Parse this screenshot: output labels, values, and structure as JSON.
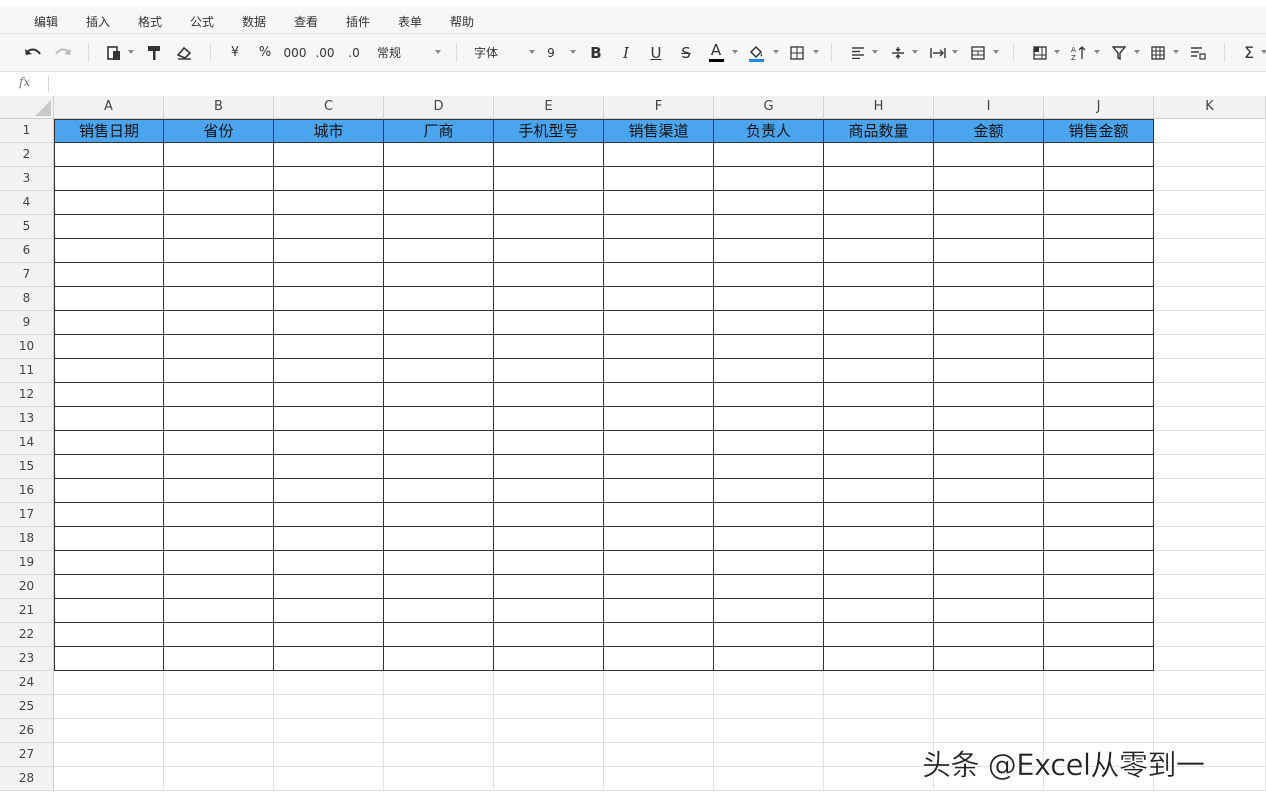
{
  "menu": [
    "编辑",
    "插入",
    "格式",
    "公式",
    "数据",
    "查看",
    "插件",
    "表单",
    "帮助"
  ],
  "toolbar": {
    "currency": "¥",
    "percent": "%",
    "thousands": "000",
    "inc_decimal": ".00",
    "dec_decimal": ".0",
    "number_format": "常规",
    "font_family": "字体",
    "font_size": "9",
    "bold": "B",
    "italic": "I",
    "underline": "U",
    "strike": "S",
    "font_color_label": "A",
    "sum": "Σ",
    "colors": {
      "font_color": "#000000",
      "fill_color": "#1e88e5"
    }
  },
  "formula_bar": {
    "fx": "fx",
    "value": ""
  },
  "columns": [
    "A",
    "B",
    "C",
    "D",
    "E",
    "F",
    "G",
    "H",
    "I",
    "J",
    "K"
  ],
  "rows": [
    "1",
    "2",
    "3",
    "4",
    "5",
    "6",
    "7",
    "8",
    "9",
    "10",
    "11",
    "12",
    "13",
    "14",
    "15",
    "16",
    "17",
    "18",
    "19",
    "20",
    "21",
    "22",
    "23",
    "24",
    "25",
    "26",
    "27",
    "28"
  ],
  "table": {
    "headers": [
      "销售日期",
      "省份",
      "城市",
      "厂商",
      "手机型号",
      "销售渠道",
      "负责人",
      "商品数量",
      "金额",
      "销售金额"
    ],
    "header_fill": "#4aa5ee",
    "bordered_last_row": 23
  },
  "watermark": "头条 @Excel从零到一"
}
